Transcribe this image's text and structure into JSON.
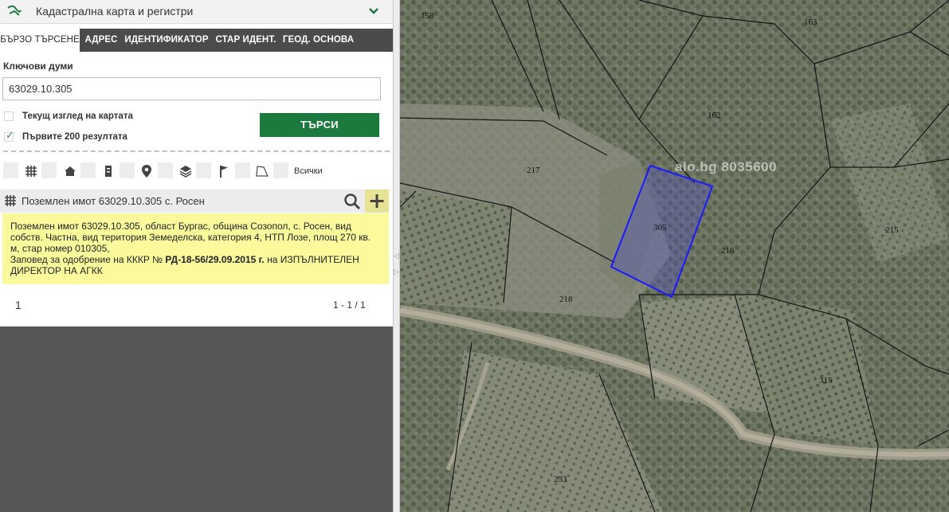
{
  "header": {
    "title": "Кадастрална карта и регистри"
  },
  "tabs": [
    {
      "label": "БЪРЗО ТЪРСЕНЕ",
      "active": true
    },
    {
      "label": "АДРЕС"
    },
    {
      "label": "ИДЕНТИФИКАТОР"
    },
    {
      "label": "СТАР ИДЕНТ."
    },
    {
      "label": "ГЕОД. ОСНОВА"
    }
  ],
  "search": {
    "keywords_label": "Ключови думи",
    "keywords_value": "63029.10.305",
    "current_view_label": "Текущ изглед на картата",
    "current_view_checked": false,
    "first200_label": "Първите 200 резултата",
    "first200_checked": true,
    "button_label": "ТЪРСИ"
  },
  "filters": {
    "icons": [
      "parcels-grid-icon",
      "home-icon",
      "building-icon",
      "location-pin-icon",
      "layers-icon",
      "flag-icon",
      "polygon-icon"
    ],
    "all_label": "Всички"
  },
  "result": {
    "title": "Поземлен имот 63029.10.305 с. Росен",
    "info_line1": "Поземлен имот 63029.10.305, област Бургас, община Созопол, с. Росен, вид собств. Частна, вид територия Земеделска, категория 4, НТП Лозе, площ 270 кв. м, стар номер 010305,",
    "order_prefix": "Заповед за одобрение на КККР № ",
    "order_number": "РД-18-56/29.09.2015 г.",
    "order_suffix": " на ИЗПЪЛНИТЕЛЕН ДИРЕКТОР НА АГКК"
  },
  "pager": {
    "page": "1",
    "range": "1 - 1 / 1"
  },
  "map": {
    "watermark": "alo.bg 8035600",
    "parcel_labels": [
      "158",
      "163",
      "162",
      "217",
      "305",
      "216",
      "215",
      "218",
      "315",
      "233"
    ],
    "colors": {
      "highlight": "#1a1aff",
      "accent_green": "#1c7a3f",
      "info_yellow": "#fafa9c"
    }
  }
}
